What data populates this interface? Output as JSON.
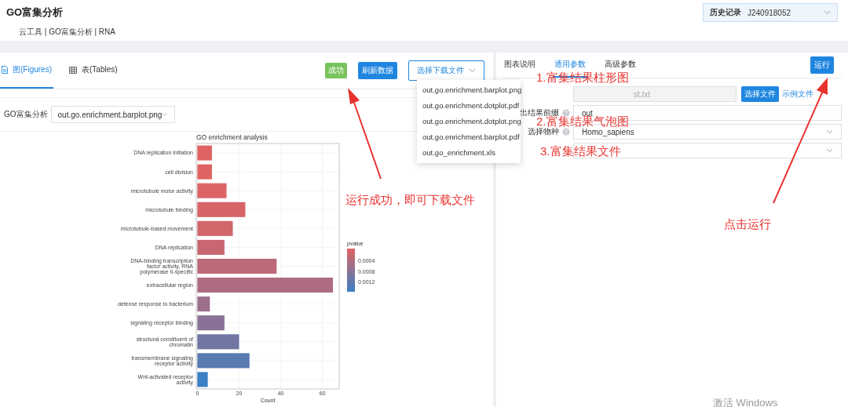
{
  "header": {
    "title": "GO富集分析",
    "breadcrumb": "云工具 | GO富集分析 | RNA",
    "history": {
      "label": "历史记录",
      "value": "J240918052"
    }
  },
  "left_panel": {
    "tabs": [
      {
        "label": "图(Figures)",
        "selected": true
      },
      {
        "label": "表(Tables)",
        "selected": false
      }
    ],
    "status": {
      "label": "成功",
      "kind": "success"
    },
    "refresh_button": "刷新数据",
    "download": {
      "label": "选择下载文件",
      "expanded": true,
      "options": [
        "out.go.enrichment.barplot.png",
        "out.go.enrichment.dotplot.pdf",
        "out.go.enrichment.dotplot.png",
        "out.go.enrichment.barplot.pdf",
        "out.go_enrichment.xls"
      ]
    },
    "figure_select": {
      "label": "GO富集分析",
      "value": "out.go.enrichment.barplot.png"
    },
    "figure": {
      "chart_data": {
        "type": "bar",
        "orientation": "horizontal",
        "title": "GO enrichment analysis",
        "xlabel": "Count",
        "grid": true,
        "categories": [
          "DNA replication initiation",
          "cell division",
          "microtubule motor activity",
          "microtubule binding",
          "microtubule-based movement",
          "DNA replication",
          "DNA-binding transcription factor activity, RNA polymerase II-specific",
          "extracellular region",
          "defense response to bacterium",
          "signaling receptor binding",
          "structural constituent of chromatin",
          "transmembrane signaling receptor activity",
          "Wnt-activated receptor activity"
        ],
        "series": [
          {
            "values": [
              7,
              7,
              14,
              23,
              17,
              13,
              38,
              65,
              6,
              13,
              20,
              25,
              5
            ]
          }
        ],
        "xlim": [
          -0.5,
          68
        ],
        "xticks": [
          0,
          20,
          40,
          60
        ]
      },
      "legend": {
        "title": "pvalue",
        "labels": [
          "0.0004",
          "0.0008",
          "0.0012"
        ]
      }
    }
  },
  "right_panel": {
    "tabs": [
      {
        "label": "图表说明",
        "selected": false
      },
      {
        "label": "通用参数",
        "selected": true
      },
      {
        "label": "高级参数",
        "selected": false
      }
    ],
    "run_button": "运行",
    "fields": [
      {
        "kind": "file",
        "placeholder": "st.txt",
        "disabled": true,
        "help": false,
        "button": "选择文件",
        "link": "示例文件"
      },
      {
        "label": "出结果前缀",
        "kind": "text",
        "value": "out",
        "disabled": false,
        "help": true
      },
      {
        "label": "选择物种",
        "kind": "select",
        "value": "Homo_sapiens",
        "disabled": false,
        "help": true
      },
      {
        "kind": "select",
        "disabled": false,
        "help": false
      }
    ]
  },
  "annotations": [
    "1.富集结果柱形图",
    "2.富集结果气泡图",
    "3.富集结果文件",
    "运行成功，即可下载文件",
    "点击运行"
  ],
  "os_notice": "激活 Windows"
}
